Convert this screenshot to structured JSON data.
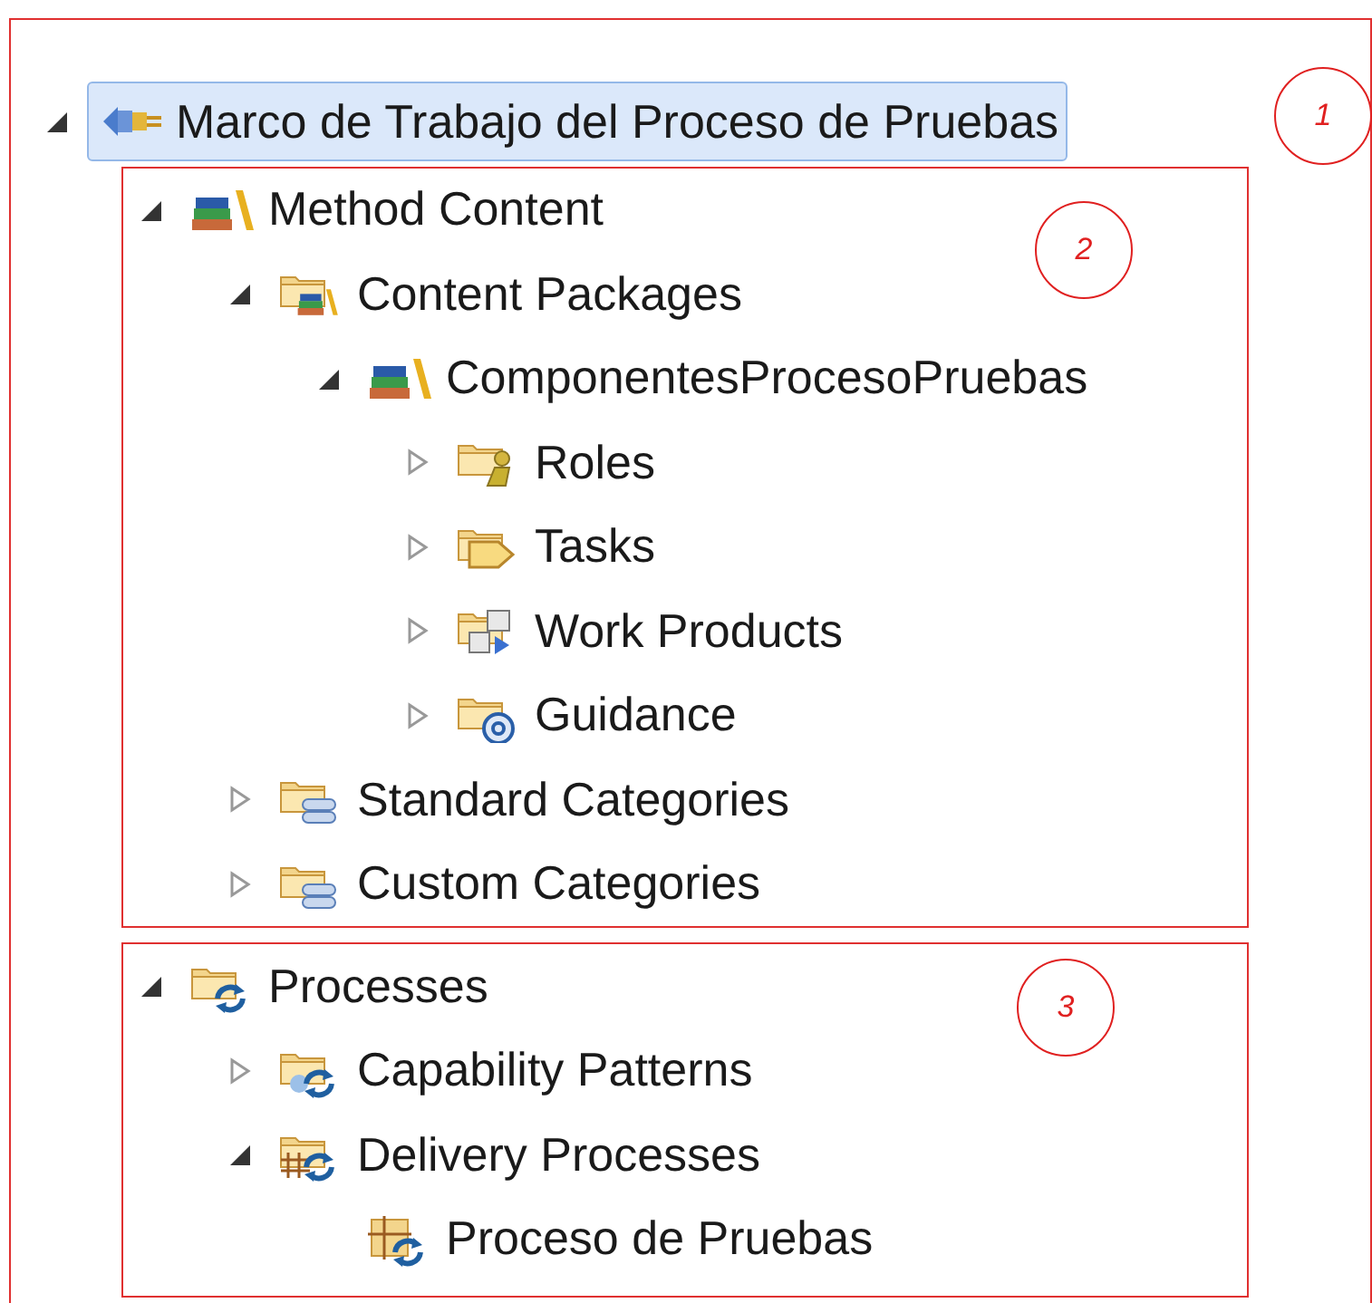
{
  "tree": {
    "label": "Marco de Trabajo del Proceso de Pruebas",
    "kind": "plugin",
    "expanded": true,
    "selected": true,
    "annotation": "1",
    "groups": [
      {
        "annotation": "2",
        "nodes": [
          {
            "label": "Method Content",
            "kind": "method-content",
            "expanded": true,
            "children": [
              {
                "label": "Content Packages",
                "kind": "content-package",
                "expanded": true,
                "children": [
                  {
                    "label": "ComponentesProcesoPruebas",
                    "kind": "method-content",
                    "expanded": true,
                    "children": [
                      {
                        "label": "Roles",
                        "kind": "roles",
                        "expanded": false
                      },
                      {
                        "label": "Tasks",
                        "kind": "tasks",
                        "expanded": false
                      },
                      {
                        "label": "Work Products",
                        "kind": "work-products",
                        "expanded": false
                      },
                      {
                        "label": "Guidance",
                        "kind": "guidance",
                        "expanded": false
                      }
                    ]
                  }
                ]
              },
              {
                "label": "Standard Categories",
                "kind": "categories",
                "expanded": false
              },
              {
                "label": "Custom Categories",
                "kind": "categories",
                "expanded": false
              }
            ]
          }
        ]
      },
      {
        "annotation": "3",
        "nodes": [
          {
            "label": "Processes",
            "kind": "processes",
            "expanded": true,
            "children": [
              {
                "label": "Capability Patterns",
                "kind": "capability-patterns",
                "expanded": false
              },
              {
                "label": "Delivery Processes",
                "kind": "delivery-processes",
                "expanded": true,
                "children": [
                  {
                    "label": "Proceso de Pruebas",
                    "kind": "delivery-process"
                  }
                ]
              }
            ]
          }
        ]
      }
    ]
  }
}
